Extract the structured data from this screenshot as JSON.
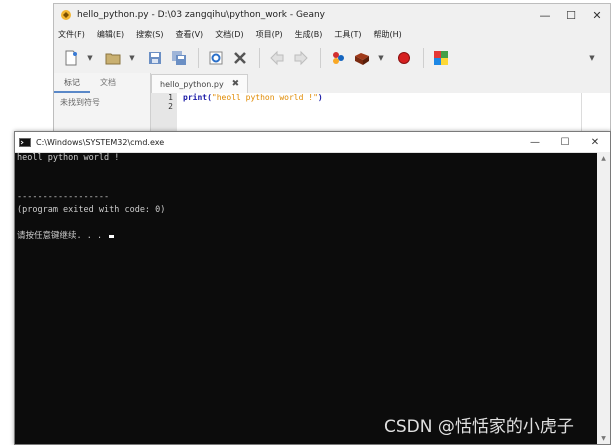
{
  "geany": {
    "title": "hello_python.py - D:\\03 zangqihu\\python_work - Geany",
    "menu": [
      "文件(F)",
      "编辑(E)",
      "搜索(S)",
      "查看(V)",
      "文档(D)",
      "项目(P)",
      "生成(B)",
      "工具(T)",
      "帮助(H)"
    ],
    "sidebar_tabs": [
      "标记",
      "文档"
    ],
    "sidebar_empty": "未找到符号",
    "file_tab": "hello_python.py",
    "line_numbers": [
      "1",
      "2"
    ],
    "code": {
      "func": "print",
      "open": "(",
      "string": "\"heoll python world !\"",
      "close": ")"
    }
  },
  "cmd": {
    "title": "C:\\Windows\\SYSTEM32\\cmd.exe",
    "lines": [
      "heoll python world !",
      "",
      "",
      "------------------",
      "(program exited with code: 0)",
      "",
      "请按任意键继续. . . "
    ]
  },
  "watermark": "CSDN @恬恬家的小虎子",
  "colors": {
    "cmd_bg": "#0c0c0c",
    "cmd_text": "#cccccc",
    "keyword": "#1a1aa6",
    "string": "#e08a00",
    "tab_accent": "#5a88c8"
  }
}
